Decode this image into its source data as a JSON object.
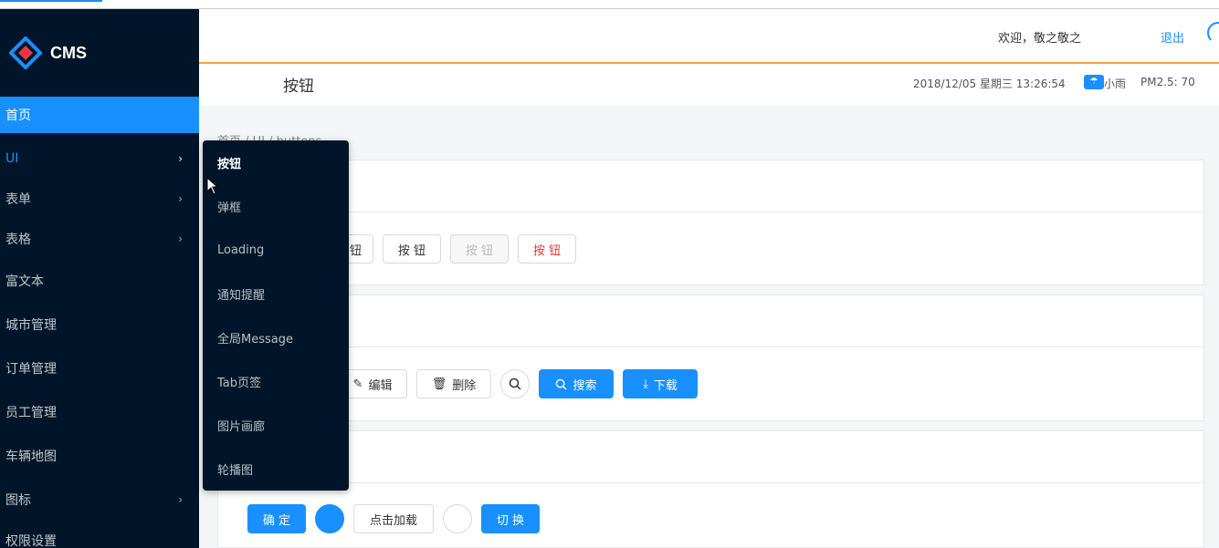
{
  "app": {
    "logo_text": "CMS"
  },
  "sidebar": {
    "items": [
      {
        "label": "首页",
        "arrow": ""
      },
      {
        "label": "UI",
        "arrow": "›"
      },
      {
        "label": "表单",
        "arrow": "›"
      },
      {
        "label": "表格",
        "arrow": "›"
      },
      {
        "label": "富文本",
        "arrow": ""
      },
      {
        "label": "城市管理",
        "arrow": ""
      },
      {
        "label": "订单管理",
        "arrow": ""
      },
      {
        "label": "员工管理",
        "arrow": ""
      },
      {
        "label": "车辆地图",
        "arrow": ""
      },
      {
        "label": "图标",
        "arrow": "›"
      },
      {
        "label": "权限设置",
        "arrow": ""
      }
    ]
  },
  "header": {
    "welcome": "欢迎，敬之敬之",
    "logout": "退出"
  },
  "subheader": {
    "title": "按钮",
    "datetime": "2018/12/05 星期三 13:26:54",
    "weather": "小雨",
    "pm25": "PM2.5: 70"
  },
  "breadcrumb": "首页 / UI / buttons",
  "card1": {
    "buttons": [
      "钮",
      "按 钮",
      "按 钮",
      "按 钮"
    ]
  },
  "card2": {
    "edit": "编辑",
    "delete": "删除",
    "search": "搜索",
    "download": "下载"
  },
  "card3": {
    "confirm": "确 定",
    "load": "点击加载",
    "toggle": "切 换"
  },
  "dropdown": {
    "items": [
      "按钮",
      "弹框",
      "Loading",
      "通知提醒",
      "全局Message",
      "Tab页签",
      "图片画廊",
      "轮播图"
    ]
  },
  "colors": {
    "sidebar_bg": "#001529",
    "primary": "#1890ff",
    "header_accent": "#f9a23b",
    "danger": "#e8383d"
  }
}
